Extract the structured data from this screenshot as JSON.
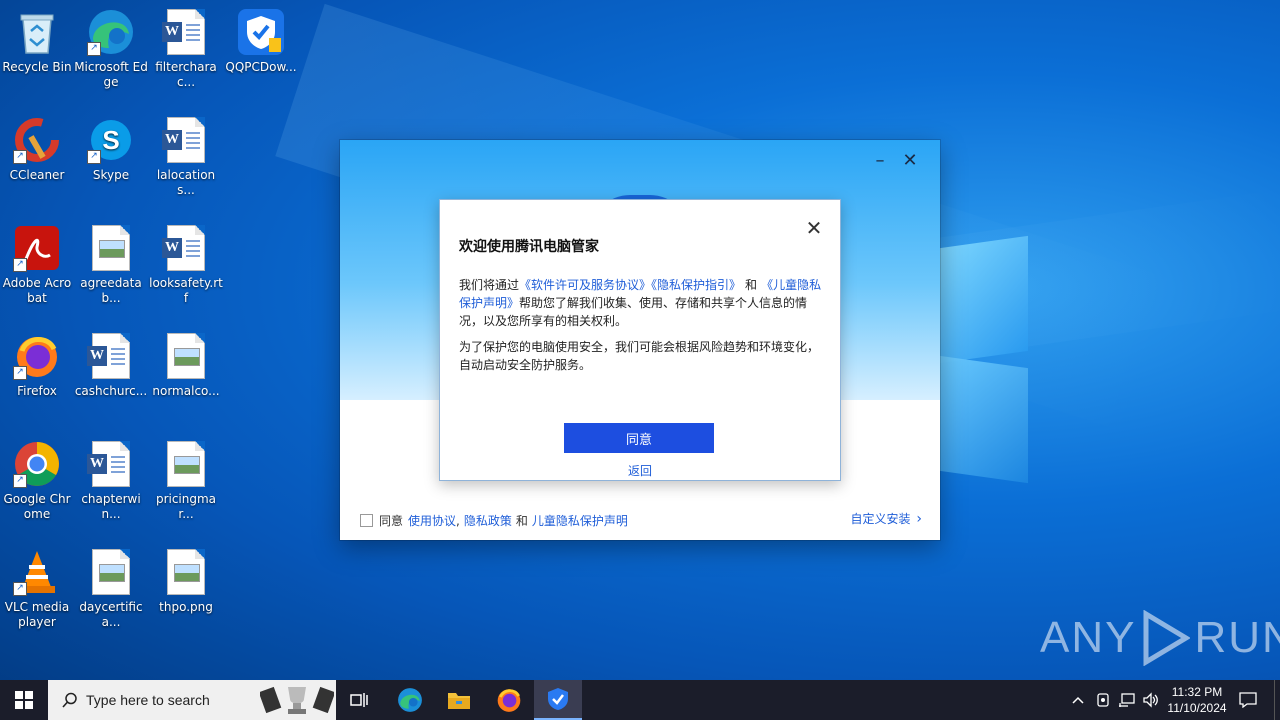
{
  "desktop": {
    "icons": [
      {
        "label": "Recycle Bin"
      },
      {
        "label": "Microsoft Edge"
      },
      {
        "label": "filtercharac..."
      },
      {
        "label": "QQPCDow..."
      },
      {
        "label": "CCleaner"
      },
      {
        "label": "Skype"
      },
      {
        "label": "lalocations..."
      },
      {
        "label": "Adobe Acrobat"
      },
      {
        "label": "agreedatab..."
      },
      {
        "label": "looksafety.rtf"
      },
      {
        "label": "Firefox"
      },
      {
        "label": "cashchurc..."
      },
      {
        "label": "normalco..."
      },
      {
        "label": "Google Chrome"
      },
      {
        "label": "chapterwin..."
      },
      {
        "label": "pricingmar..."
      },
      {
        "label": "VLC media player"
      },
      {
        "label": "daycertifica..."
      },
      {
        "label": "thpo.png"
      }
    ]
  },
  "installer": {
    "minimize_glyph": "–",
    "close_glyph": "✕",
    "agree_prefix": "同意",
    "link_terms": "使用协议",
    "sep1": ",",
    "link_privacy": "隐私政策",
    "and": "和",
    "link_children": "儿童隐私保护声明",
    "custom_install": "自定义安装",
    "custom_arrow": "›"
  },
  "modal": {
    "close_glyph": "✕",
    "title": "欢迎使用腾讯电脑管家",
    "p1_prefix": "我们将通过",
    "p1_link1": "《软件许可及服务协议》",
    "p1_link2": "《隐私保护指引》",
    "p1_and": "和",
    "p1_link3": "《儿童隐私保护声明》",
    "p1_suffix": "帮助您了解我们收集、使用、存储和共享个人信息的情况，以及您所享有的相关权利。",
    "p2": "为了保护您的电脑使用安全，我们可能会根据风险趋势和环境变化，自动启动安全防护服务。",
    "agree_button": "同意",
    "back_link": "返回"
  },
  "watermark": {
    "left": "ANY",
    "right": "RUN"
  },
  "taskbar": {
    "search_placeholder": "Type here to search",
    "time": "11:32 PM",
    "date": "11/10/2024",
    "tray_chevron": "^"
  }
}
